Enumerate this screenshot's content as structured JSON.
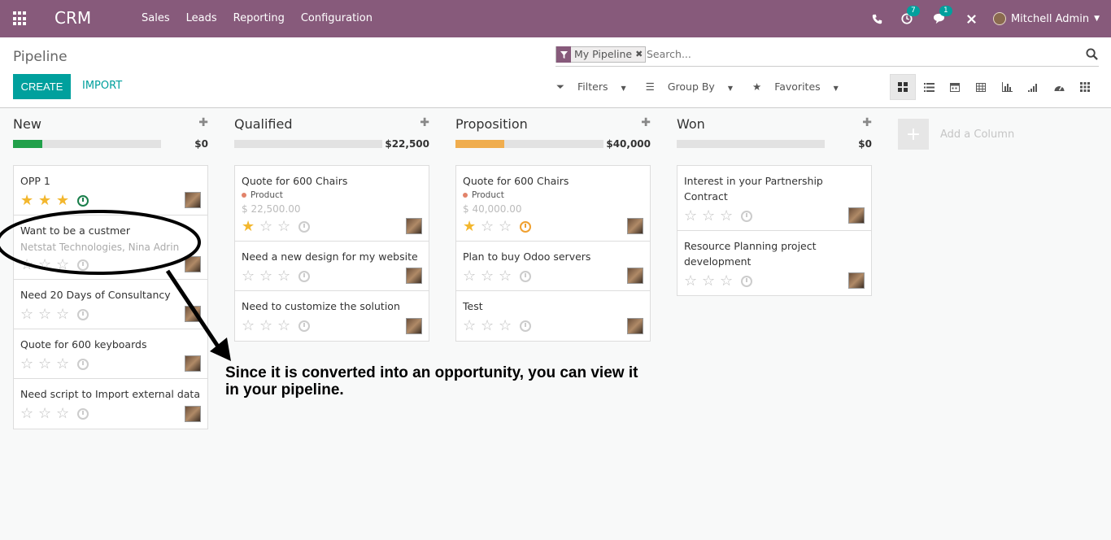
{
  "navbar": {
    "brand": "CRM",
    "menu": [
      "Sales",
      "Leads",
      "Reporting",
      "Configuration"
    ],
    "activity_count": "7",
    "message_count": "1",
    "user_name": "Mitchell Admin",
    "icons": [
      "apps-icon",
      "phone-icon",
      "activity-icon",
      "chat-icon",
      "close-icon"
    ]
  },
  "control_panel": {
    "breadcrumb": "Pipeline",
    "create_label": "CREATE",
    "import_label": "IMPORT",
    "search": {
      "facet_value": "My Pipeline",
      "placeholder": "Search..."
    },
    "filters_label": "Filters",
    "groupby_label": "Group By",
    "favorites_label": "Favorites",
    "views": [
      "kanban",
      "list",
      "calendar",
      "pivot",
      "graph",
      "cohort",
      "dashboard",
      "grid"
    ]
  },
  "columns": [
    {
      "title": "New",
      "total": "$0",
      "progress": {
        "color": "#21a04a",
        "fraction": 0.2
      },
      "cards": [
        {
          "title": "OPP 1",
          "stars": 3,
          "clock": "green"
        },
        {
          "title": "Want to be a custmer",
          "subtitle": "Netstat Technologies, Nina Adrin",
          "stars": 0,
          "clock": "grey"
        },
        {
          "title": "Need 20 Days of Consultancy",
          "stars": 0,
          "clock": "grey"
        },
        {
          "title": "Quote for 600 keyboards",
          "stars": 0,
          "clock": "grey"
        },
        {
          "title": "Need script to Import external data",
          "stars": 0,
          "clock": "grey"
        }
      ]
    },
    {
      "title": "Qualified",
      "total": "$22,500",
      "progress": {
        "color": "#e2e2e2",
        "fraction": 0
      },
      "cards": [
        {
          "title": "Quote for 600 Chairs",
          "tag": "Product",
          "amount": "$ 22,500.00",
          "stars": 1,
          "clock": "grey"
        },
        {
          "title": "Need a new design for my website",
          "stars": 0,
          "clock": "grey"
        },
        {
          "title": "Need to customize the solution",
          "stars": 0,
          "clock": "grey"
        }
      ]
    },
    {
      "title": "Proposition",
      "total": "$40,000",
      "progress": {
        "color": "#f0ad4e",
        "fraction": 0.33
      },
      "cards": [
        {
          "title": "Quote for 600 Chairs",
          "tag": "Product",
          "amount": "$ 40,000.00",
          "stars": 1,
          "clock": "orange"
        },
        {
          "title": "Plan to buy Odoo servers",
          "stars": 0,
          "clock": "grey"
        },
        {
          "title": "Test",
          "stars": 0,
          "clock": "grey"
        }
      ]
    },
    {
      "title": "Won",
      "total": "$0",
      "progress": {
        "color": "#e2e2e2",
        "fraction": 0
      },
      "cards": [
        {
          "title": "Interest in your Partnership Contract",
          "stars": 0,
          "clock": "grey"
        },
        {
          "title": "Resource Planning project development",
          "stars": 0,
          "clock": "grey"
        }
      ]
    }
  ],
  "add_column_label": "Add a Column",
  "annotation": {
    "text": "Since it is converted into an opportunity, you can view it in your pipeline."
  }
}
